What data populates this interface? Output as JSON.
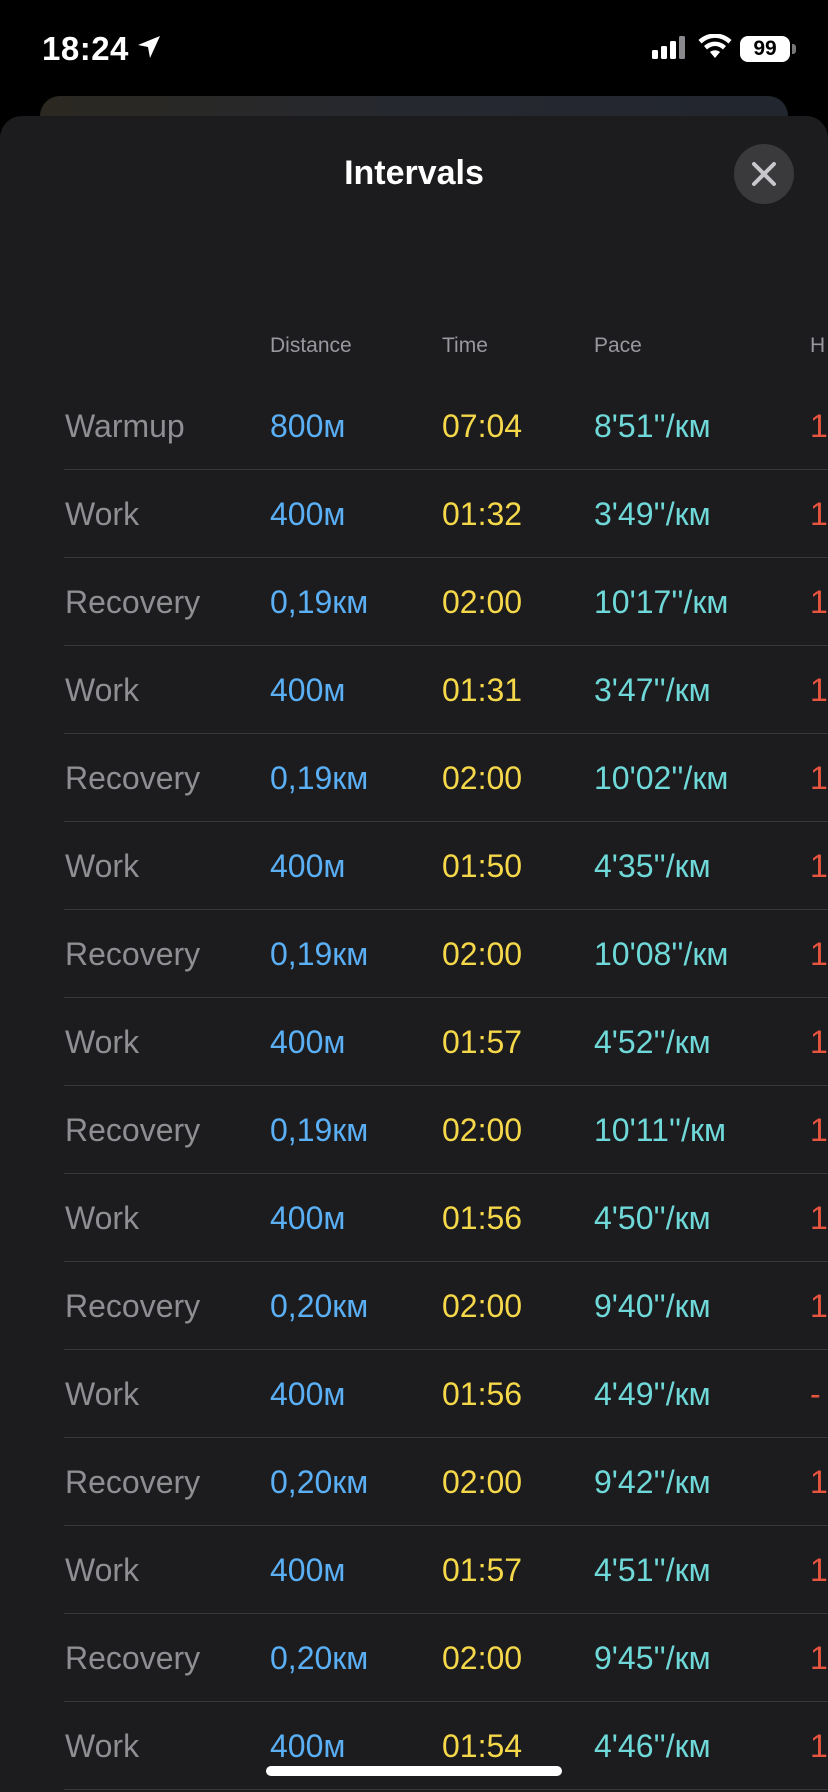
{
  "status_bar": {
    "time": "18:24",
    "battery": "99",
    "icons": [
      "location-arrow-icon",
      "signal-icon",
      "wifi-icon",
      "battery-icon"
    ]
  },
  "sheet": {
    "title": "Intervals",
    "close_icon": "close-icon"
  },
  "table": {
    "headers": {
      "distance": "Distance",
      "time": "Time",
      "pace": "Pace",
      "hr": "H"
    },
    "rows": [
      {
        "type": "Warmup",
        "distance": "800м",
        "time": "07:04",
        "pace": "8'51''/км",
        "hr": "1"
      },
      {
        "type": "Work",
        "distance": "400м",
        "time": "01:32",
        "pace": "3'49''/км",
        "hr": "1"
      },
      {
        "type": "Recovery",
        "distance": "0,19км",
        "time": "02:00",
        "pace": "10'17''/км",
        "hr": "1"
      },
      {
        "type": "Work",
        "distance": "400м",
        "time": "01:31",
        "pace": "3'47''/км",
        "hr": "1"
      },
      {
        "type": "Recovery",
        "distance": "0,19км",
        "time": "02:00",
        "pace": "10'02''/км",
        "hr": "1"
      },
      {
        "type": "Work",
        "distance": "400м",
        "time": "01:50",
        "pace": "4'35''/км",
        "hr": "1"
      },
      {
        "type": "Recovery",
        "distance": "0,19км",
        "time": "02:00",
        "pace": "10'08''/км",
        "hr": "1"
      },
      {
        "type": "Work",
        "distance": "400м",
        "time": "01:57",
        "pace": "4'52''/км",
        "hr": "1"
      },
      {
        "type": "Recovery",
        "distance": "0,19км",
        "time": "02:00",
        "pace": "10'11''/км",
        "hr": "1"
      },
      {
        "type": "Work",
        "distance": "400м",
        "time": "01:56",
        "pace": "4'50''/км",
        "hr": "1"
      },
      {
        "type": "Recovery",
        "distance": "0,20км",
        "time": "02:00",
        "pace": "9'40''/км",
        "hr": "1"
      },
      {
        "type": "Work",
        "distance": "400м",
        "time": "01:56",
        "pace": "4'49''/км",
        "hr": "-"
      },
      {
        "type": "Recovery",
        "distance": "0,20км",
        "time": "02:00",
        "pace": "9'42''/км",
        "hr": "1"
      },
      {
        "type": "Work",
        "distance": "400м",
        "time": "01:57",
        "pace": "4'51''/км",
        "hr": "1"
      },
      {
        "type": "Recovery",
        "distance": "0,20км",
        "time": "02:00",
        "pace": "9'45''/км",
        "hr": "1"
      },
      {
        "type": "Work",
        "distance": "400м",
        "time": "01:54",
        "pace": "4'46''/км",
        "hr": "1"
      }
    ]
  },
  "colors": {
    "distance": "#5aaff5",
    "time": "#f5d84a",
    "pace": "#6fd9d9",
    "hr": "#e8553f",
    "label": "#8e8e93"
  }
}
